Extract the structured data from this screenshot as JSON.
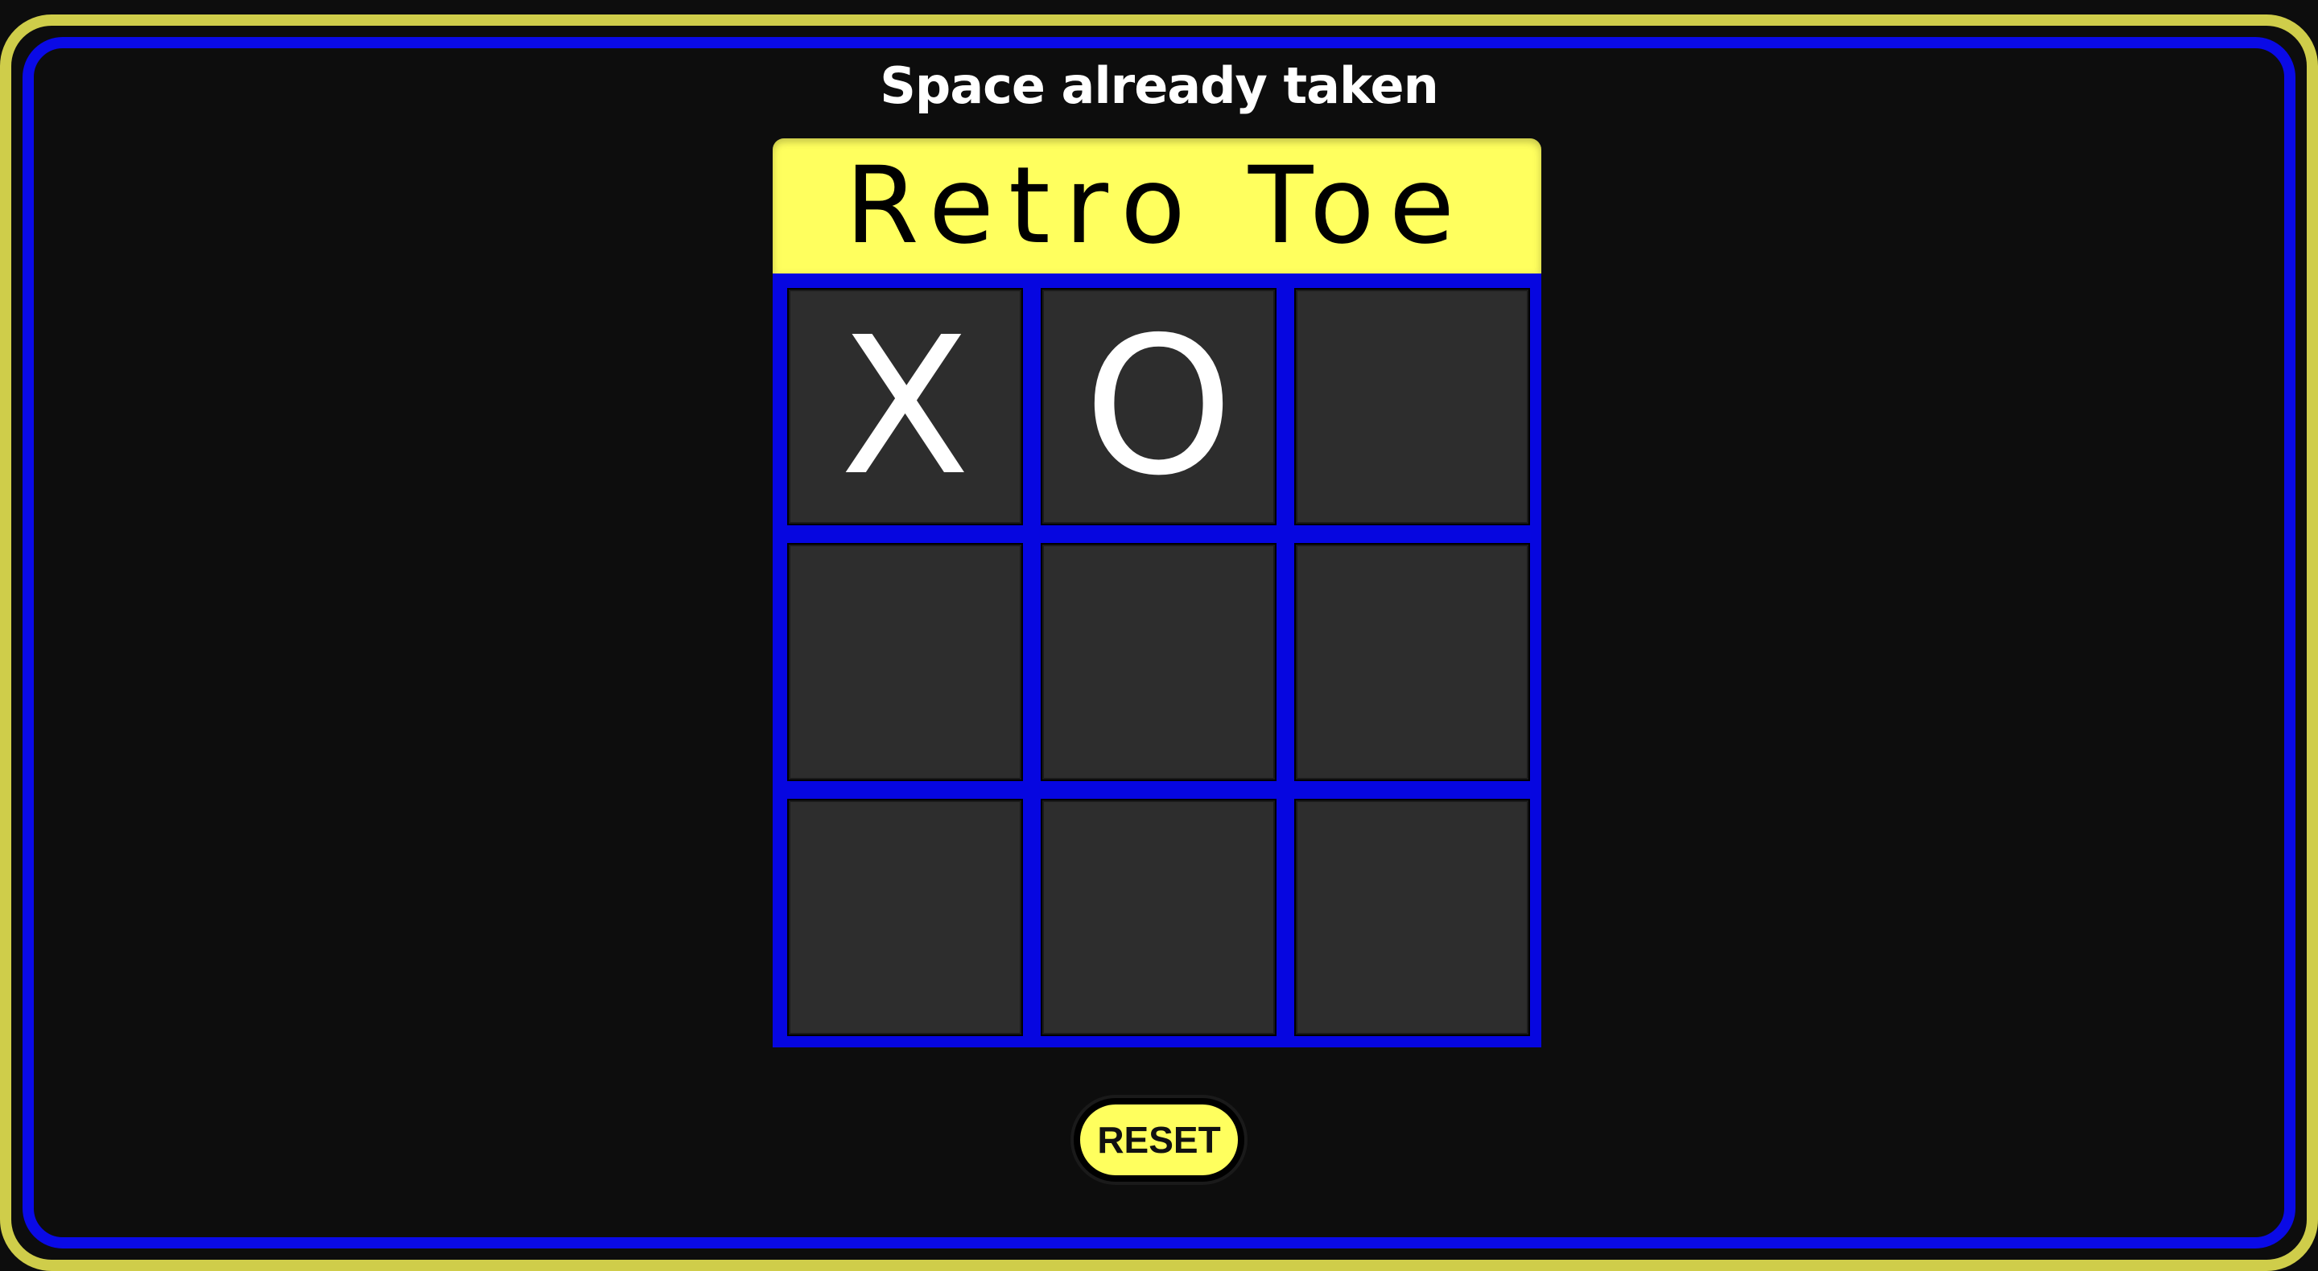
{
  "status": {
    "message": "Space already taken"
  },
  "game": {
    "title": "Retro Toe",
    "board": [
      [
        "X",
        "O",
        ""
      ],
      [
        "",
        "",
        ""
      ],
      [
        "",
        "",
        ""
      ]
    ]
  },
  "controls": {
    "reset_label": "RESET"
  },
  "colors": {
    "background": "#0d0d0d",
    "accent_yellow": "#ffff5e",
    "board_blue": "#0606e0",
    "cell_gray": "#2d2d2d",
    "outer_frame": "#cfcd4a"
  }
}
